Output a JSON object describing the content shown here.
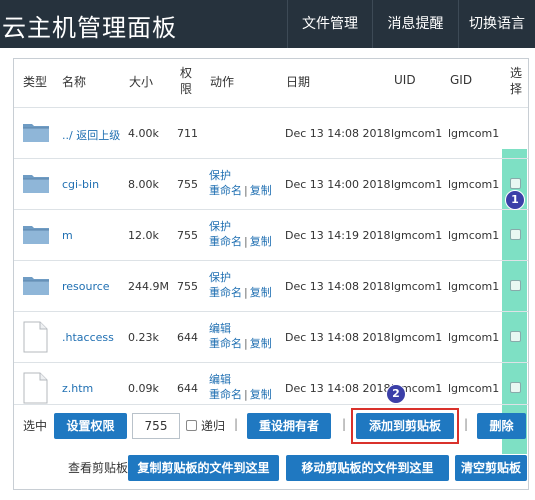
{
  "header": {
    "title": "云主机管理面板",
    "nav": [
      "文件管理",
      "消息提醒",
      "切换语言"
    ]
  },
  "table": {
    "columns": {
      "type": "类型",
      "name": "名称",
      "size": "大小",
      "perm": [
        "权",
        "限"
      ],
      "action": "动作",
      "date": "日期",
      "uid": "UID",
      "gid": "GID",
      "select": [
        "选",
        "择"
      ]
    },
    "rows": [
      {
        "kind": "folder",
        "name": "../ 返回上级",
        "size": "4.00k",
        "perm": "711",
        "actions": [],
        "date": "Dec 13 14:08 2018",
        "uid": "lgmcom1",
        "gid": "lgmcom1",
        "checkbox": false
      },
      {
        "kind": "folder",
        "name": "cgi-bin",
        "size": "8.00k",
        "perm": "755",
        "actions": [
          "保护",
          "重命名",
          "复制"
        ],
        "date": "Dec 13 14:00 2018",
        "uid": "lgmcom1",
        "gid": "lgmcom1",
        "checkbox": true
      },
      {
        "kind": "folder",
        "name": "m",
        "size": "12.0k",
        "perm": "755",
        "actions": [
          "保护",
          "重命名",
          "复制"
        ],
        "date": "Dec 13 14:19 2018",
        "uid": "lgmcom1",
        "gid": "lgmcom1",
        "checkbox": true
      },
      {
        "kind": "folder",
        "name": "resource",
        "size": "244.9M",
        "perm": "755",
        "actions": [
          "保护",
          "重命名",
          "复制"
        ],
        "date": "Dec 13 14:08 2018",
        "uid": "lgmcom1",
        "gid": "lgmcom1",
        "checkbox": true
      },
      {
        "kind": "file",
        "name": ".htaccess",
        "size": "0.23k",
        "perm": "644",
        "actions": [
          "编辑",
          "重命名",
          "复制"
        ],
        "date": "Dec 13 14:08 2018",
        "uid": "lgmcom1",
        "gid": "lgmcom1",
        "checkbox": true
      },
      {
        "kind": "file",
        "name": "z.htm",
        "size": "0.09k",
        "perm": "644",
        "actions": [
          "编辑",
          "重命名",
          "复制"
        ],
        "date": "Dec 13 14:08 2018",
        "uid": "lgmcom1",
        "gid": "lgmcom1",
        "checkbox": true
      }
    ],
    "separator": "|"
  },
  "toolbar": {
    "selected_label": "选中",
    "set_perm": "设置权限",
    "perm_value": "755",
    "recursive_label": "递归",
    "reset_owner": "重设拥有者",
    "add_clipboard": "添加到剪贴板",
    "delete": "删除",
    "view_clipboard_label": "查看剪贴板",
    "copy_here": "复制剪贴板的文件到这里",
    "move_here": "移动剪贴板的文件到这里",
    "clear_clipboard": "清空剪贴板",
    "divider": "|"
  },
  "annotations": {
    "badge1": "1",
    "badge2": "2"
  },
  "colors": {
    "header": "#26323d",
    "button": "#1f78c1",
    "link": "#1f6fb2",
    "highlight": "#7ee0c4",
    "annotation_box": "#d9312b",
    "badge": "#3b3fa8"
  }
}
